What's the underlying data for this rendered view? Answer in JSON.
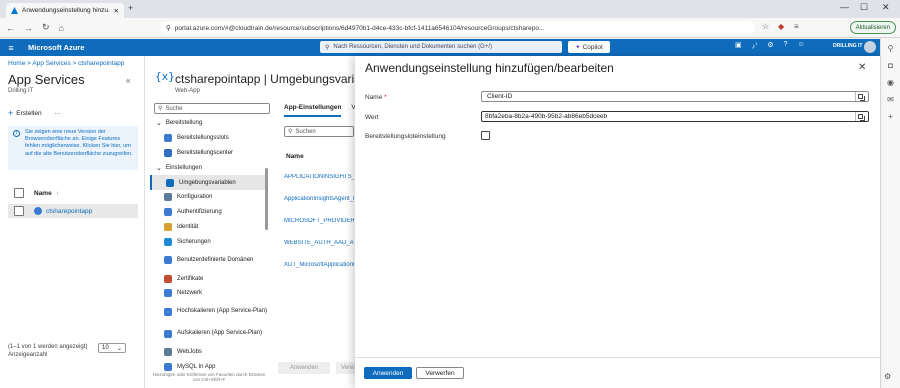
{
  "browser": {
    "tab_title": "Anwendungseinstellung hinzu...",
    "url": "portal.azure.com/#@cloudtrain.de/resource/subscriptions/6d4970b1-d4ce-433c-bfcf-1411a6546104/resourceGroups/ctsharepo...",
    "update_label": "Aktualisieren"
  },
  "azure": {
    "brand": "Microsoft Azure",
    "search_placeholder": "Nach Ressourcen, Diensten und Dokumenten suchen (G+/)",
    "copilot_label": "Copilot",
    "account": "DRILLING IT",
    "notification_count": "1"
  },
  "left": {
    "breadcrumb": [
      "Home",
      "App Services",
      "ctsharepointapp"
    ],
    "title": "App Services",
    "subtitle": "Drilling IT",
    "create_label": "Erstellen",
    "info_text": "Sie zeigen eine neue Version der Browseroberfläche an. Einige Features fehlen möglicherweise. Klicken Sie hier, um auf die alte Benutzeroberfläche zuzugreifen.",
    "name_header": "Name",
    "row_name": "ctsharepointapp",
    "page_info": "(1–1 von 1 werden angezeigt) Anzeigeanzahl",
    "page_size": "10"
  },
  "resource": {
    "title": "ctsharepointapp | Umgebungsvariablen",
    "subtitle": "Web-App",
    "search_placeholder": "Suche",
    "nav": [
      {
        "label": "Bereitstellung",
        "group": true
      },
      {
        "label": "Bereitstellungsslots",
        "color": "#3b7bd4"
      },
      {
        "label": "Bereitstellungscenter",
        "color": "#2f6fc2"
      },
      {
        "label": "Einstellungen",
        "group": true
      },
      {
        "label": "Umgebungsvariablen",
        "color": "#0f6cbd",
        "selected": true
      },
      {
        "label": "Konfiguration",
        "color": "#5c7a99"
      },
      {
        "label": "Authentifizierung",
        "color": "#3b7bd4"
      },
      {
        "label": "Identität",
        "color": "#d69e2e"
      },
      {
        "label": "Sicherungen",
        "color": "#1f8ad6"
      },
      {
        "label": "Benutzerdefinierte Domänen",
        "color": "#3b7bd4",
        "two": true
      },
      {
        "label": "Zertifikate",
        "color": "#c44d31"
      },
      {
        "label": "Netzwerk",
        "color": "#3b7bd4"
      },
      {
        "label": "Hochskalieren (App Service-Plan)",
        "color": "#3b7bd4",
        "two": true
      },
      {
        "label": "Aufskalieren (App Service-Plan)",
        "color": "#3b7bd4",
        "two": true
      },
      {
        "label": "WebJobs",
        "color": "#5c7a99"
      },
      {
        "label": "MySQL In App",
        "color": "#3b7bd4"
      }
    ],
    "nav_hint": "Hinzufügen oder Entfernen von Favoriten durch Drücken von Ctrl+Shift+F"
  },
  "content": {
    "tabs": [
      "App-Einstellungen",
      "Ve"
    ],
    "search_placeholder": "Suchen",
    "col_name": "Name",
    "rows": [
      "APPLICATIONINSIGHTS_CONNECTION_STRING",
      "ApplicationInsightsAgent_EXTENSION_VERSION",
      "MICROSOFT_PROVIDER_AUTHENTICATION_SECRET",
      "WEBSITE_AUTH_AAD_ALLOWED_TENANTS",
      "XDT_MicrosoftApplicationInsights_Mode"
    ],
    "apply_label": "Anwenden",
    "other_label": "Verw"
  },
  "dialog": {
    "title": "Anwendungseinstellung hinzufügen/bearbeiten",
    "name_label": "Name",
    "required_marker": "*",
    "name_value": "Client-ID",
    "value_label": "Wert",
    "value_value": "8bfa2eba-8b2a-490b-95b2-ab86eb5dceeb",
    "slot_label": "Bereitstellungsloteinstellung",
    "slot_checked": false,
    "apply_label": "Anwenden",
    "discard_label": "Verwerfen"
  }
}
